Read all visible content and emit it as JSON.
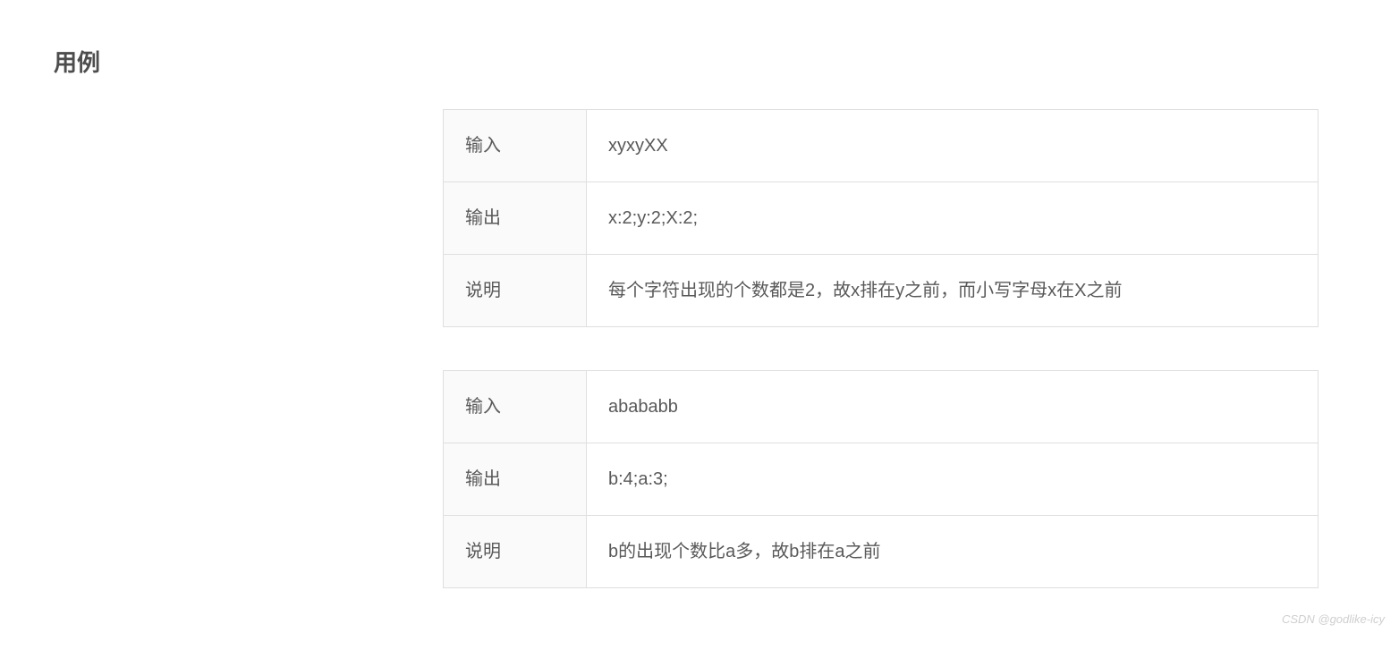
{
  "heading": "用例",
  "tables": [
    {
      "rows": [
        {
          "label": "输入",
          "value": "xyxyXX"
        },
        {
          "label": "输出",
          "value": "x:2;y:2;X:2;"
        },
        {
          "label": "说明",
          "value": "每个字符出现的个数都是2，故x排在y之前，而小写字母x在X之前"
        }
      ]
    },
    {
      "rows": [
        {
          "label": "输入",
          "value": "abababb"
        },
        {
          "label": "输出",
          "value": "b:4;a:3;"
        },
        {
          "label": "说明",
          "value": "b的出现个数比a多，故b排在a之前"
        }
      ]
    }
  ],
  "watermark": "CSDN @godlike-icy"
}
